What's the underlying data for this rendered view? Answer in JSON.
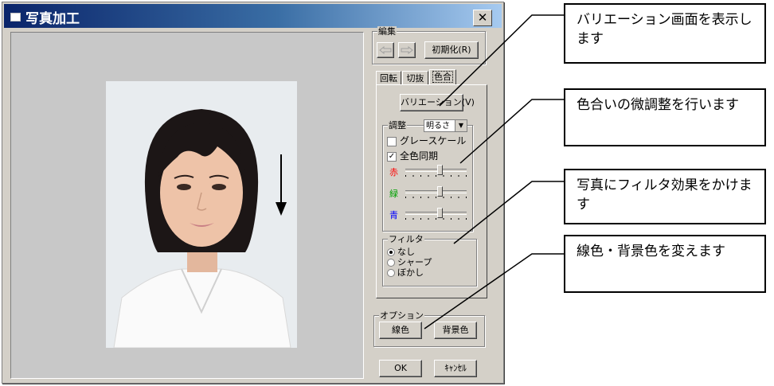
{
  "window": {
    "title": "写真加工",
    "close_label": "✕"
  },
  "edit_group": {
    "label": "編集",
    "undo_label": "<=",
    "redo_label": "=>",
    "reset_label": "初期化(R)"
  },
  "tabs": [
    {
      "label": "回転",
      "active": false
    },
    {
      "label": "切抜",
      "active": false
    },
    {
      "label": "色合",
      "active": true
    }
  ],
  "color_tab": {
    "variation_button": "バリエーション(V)",
    "adjust_label": "調整",
    "adjust_select": "明るさ",
    "grayscale_label": "グレースケール",
    "grayscale_checked": false,
    "sync_label": "全色同期",
    "sync_checked": true,
    "sliders": [
      {
        "label": "赤",
        "color": "#ff0000",
        "value": 0.55
      },
      {
        "label": "緑",
        "color": "#00a000",
        "value": 0.55
      },
      {
        "label": "青",
        "color": "#0000ff",
        "value": 0.55
      }
    ],
    "filter_label": "フィルタ",
    "filter_options": [
      {
        "label": "なし",
        "selected": true
      },
      {
        "label": "シャープ",
        "selected": false
      },
      {
        "label": "ぼかし",
        "selected": false
      }
    ]
  },
  "options_group": {
    "label": "オプション",
    "line_color_button": "線色",
    "bg_color_button": "背景色"
  },
  "dialog_buttons": {
    "ok": "OK",
    "cancel": "ｷｬﾝｾﾙ"
  },
  "callouts": [
    {
      "text": "バリエーション画面を表示します"
    },
    {
      "text": "色合いの微調整を行います"
    },
    {
      "text": "写真にフィルタ効果をかけます"
    },
    {
      "text": "線色・背景色を変えます"
    }
  ]
}
